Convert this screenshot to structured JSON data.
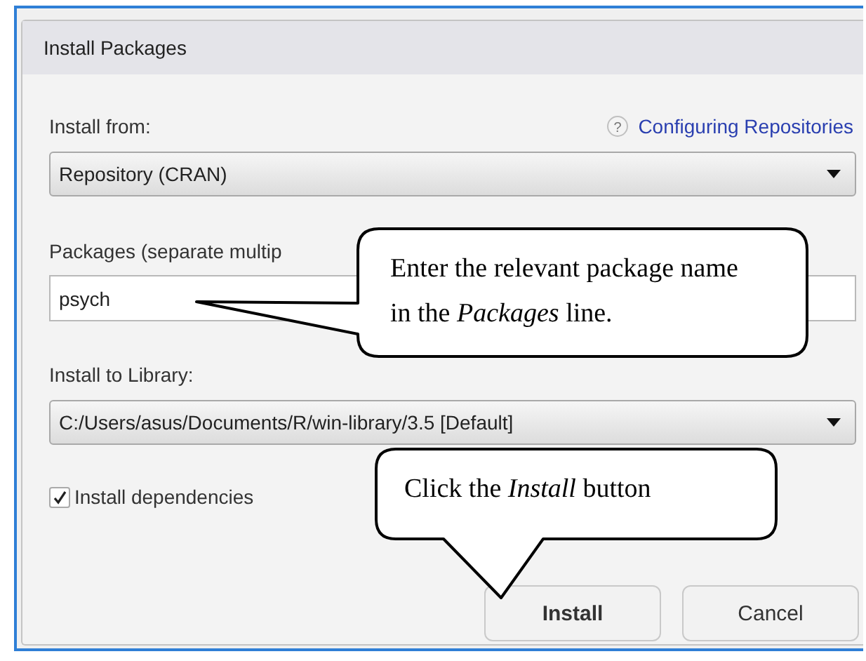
{
  "window": {
    "title": "Install Packages"
  },
  "install_from": {
    "label": "Install from:",
    "help_icon": "?",
    "help_link": "Configuring Repositories",
    "value": "Repository (CRAN)"
  },
  "packages": {
    "label": "Packages (separate multip",
    "value": "psych"
  },
  "library": {
    "label": "Install to Library:",
    "value": "C:/Users/asus/Documents/R/win-library/3.5 [Default]"
  },
  "dependencies": {
    "label": "Install dependencies",
    "checked": true
  },
  "buttons": [
    {
      "label": "Install",
      "default": true
    },
    {
      "label": "Cancel",
      "default": false
    }
  ],
  "callouts": [
    {
      "text": "Enter the relevant package name in the *Packages* line."
    },
    {
      "text": "Click the *Install* button"
    }
  ]
}
